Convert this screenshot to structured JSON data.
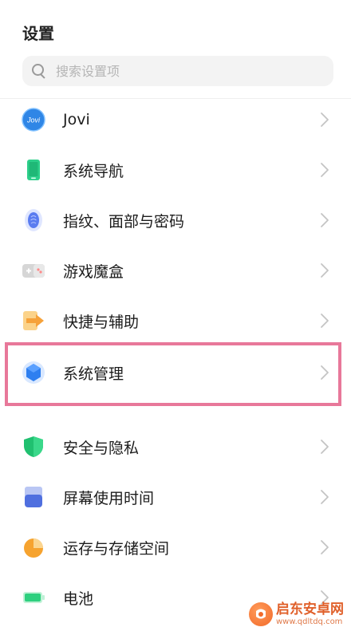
{
  "header": {
    "title": "设置"
  },
  "search": {
    "placeholder": "搜索设置项",
    "icon": "search-icon"
  },
  "highlight_color": "#e8789a",
  "items": [
    {
      "label": "Jovi",
      "icon": "jovi-icon",
      "icon_text": "Jovi",
      "color": "#2f86e6"
    },
    {
      "label": "系统导航",
      "icon": "phone-icon",
      "color": "#2ccf8a"
    },
    {
      "label": "指纹、面部与密码",
      "icon": "fingerprint-icon",
      "color": "#5a7cf0"
    },
    {
      "label": "游戏魔盒",
      "icon": "gamepad-icon",
      "color": "#c9c9c9"
    },
    {
      "label": "快捷与辅助",
      "icon": "shortcut-icon",
      "color": "#f6a23a"
    },
    {
      "label": "系统管理",
      "icon": "hexagon-icon",
      "color": "#2e7ff0"
    },
    {
      "label": "安全与隐私",
      "icon": "shield-icon",
      "color": "#20c070"
    },
    {
      "label": "屏幕使用时间",
      "icon": "screen-time-icon",
      "color": "#6d86e6"
    },
    {
      "label": "运存与存储空间",
      "icon": "storage-pie-icon",
      "color": "#f6a32f"
    },
    {
      "label": "电池",
      "icon": "battery-icon",
      "color": "#2ed07f"
    }
  ],
  "watermark": {
    "name": "启东安卓网",
    "url": "www.qdltdq.com"
  }
}
